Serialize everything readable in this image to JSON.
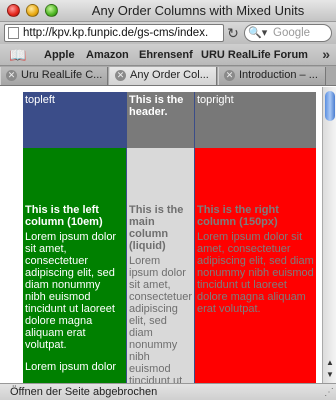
{
  "window": {
    "title": "Any Order Columns with Mixed Units"
  },
  "toolbar": {
    "url": "http://kpv.kp.funpic.de/gs-cms/index.",
    "search_placeholder": "Google"
  },
  "bookmarks": {
    "items": [
      "Apple",
      "Amazon",
      "Ehrensenf",
      "URU RealLife Forum"
    ],
    "overflow_glyph": "»"
  },
  "tabs": [
    {
      "label": "Uru RealLife C...",
      "active": false
    },
    {
      "label": "Any Order Col...",
      "active": true
    },
    {
      "label": "Introduction – ...",
      "active": false
    }
  ],
  "page": {
    "colors": {
      "left_header": "#3b4d89",
      "main_header": "#7a7a7a",
      "right_header": "#787878",
      "left_body": "#008000",
      "main_body": "#d9d9d9",
      "right_body": "#ff0000"
    },
    "topleft": "topleft",
    "header": "This is the header.",
    "topright": "topright",
    "left_heading": "This is the left column (10em)",
    "main_heading": "This is the main column (liquid)",
    "right_heading": "This is the right column (150px)",
    "lorem": "Lorem ipsum dolor sit amet, consectetuer adipiscing elit, sed diam nonummy nibh euismod tincidunt ut laoreet dolore magna aliquam erat volutpat.",
    "lorem_main": "Lorem ipsum dolor sit amet, consectetuer adipiscing elit, sed diam nonummy nibh euismod tincidunt ut laoreet",
    "lorem_left_2": "Lorem ipsum dolor"
  },
  "status": {
    "text": "Öffnen der Seite abgebrochen"
  }
}
